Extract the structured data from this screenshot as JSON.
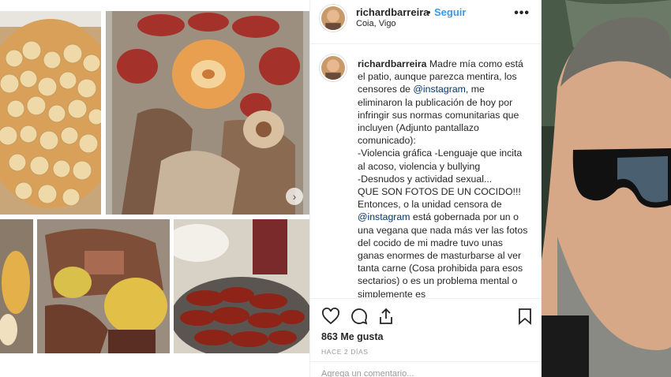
{
  "post": {
    "username": "richardbarreira",
    "separator": "•",
    "follow_label": "Seguir",
    "location": "Coia, Vigo",
    "more_icon": "more-options-icon",
    "caption_username": "richardbarreira",
    "caption_parts": [
      " Madre mía como está el patio, aunque parezca mentira, los censores de ",
      "@instagram",
      ", me eliminaron la publicación de hoy por infringir sus normas comunitarias que incluyen (Adjunto pantallazo comunicado):\n-Violencia gráfica -Lenguaje que incita al acoso, violencia y bullying\n-Desnudos y actividad sexual...\nQUE SON FOTOS DE UN COCIDO!!!\nEntonces, o la unidad censora de ",
      "@instagram",
      " está gobernada por un o una vegana que nada más ver las fotos del cocido de mi madre tuvo unas ganas enormes de masturbarse al ver tanta carne (Cosa prohibida para esos sectarios) o es un problema mental o simplemente es"
    ],
    "likes": "863 Me gusta",
    "time_ago": "HACE 2 DÍAS",
    "add_comment_placeholder": "Agrega un comentario..."
  },
  "icons": [
    "heart-icon",
    "comment-icon",
    "share-icon",
    "bookmark-icon",
    "chevron-right-icon"
  ],
  "colors": {
    "link": "#3897f0",
    "mention": "#003569",
    "text": "#262626",
    "muted": "#999999"
  }
}
